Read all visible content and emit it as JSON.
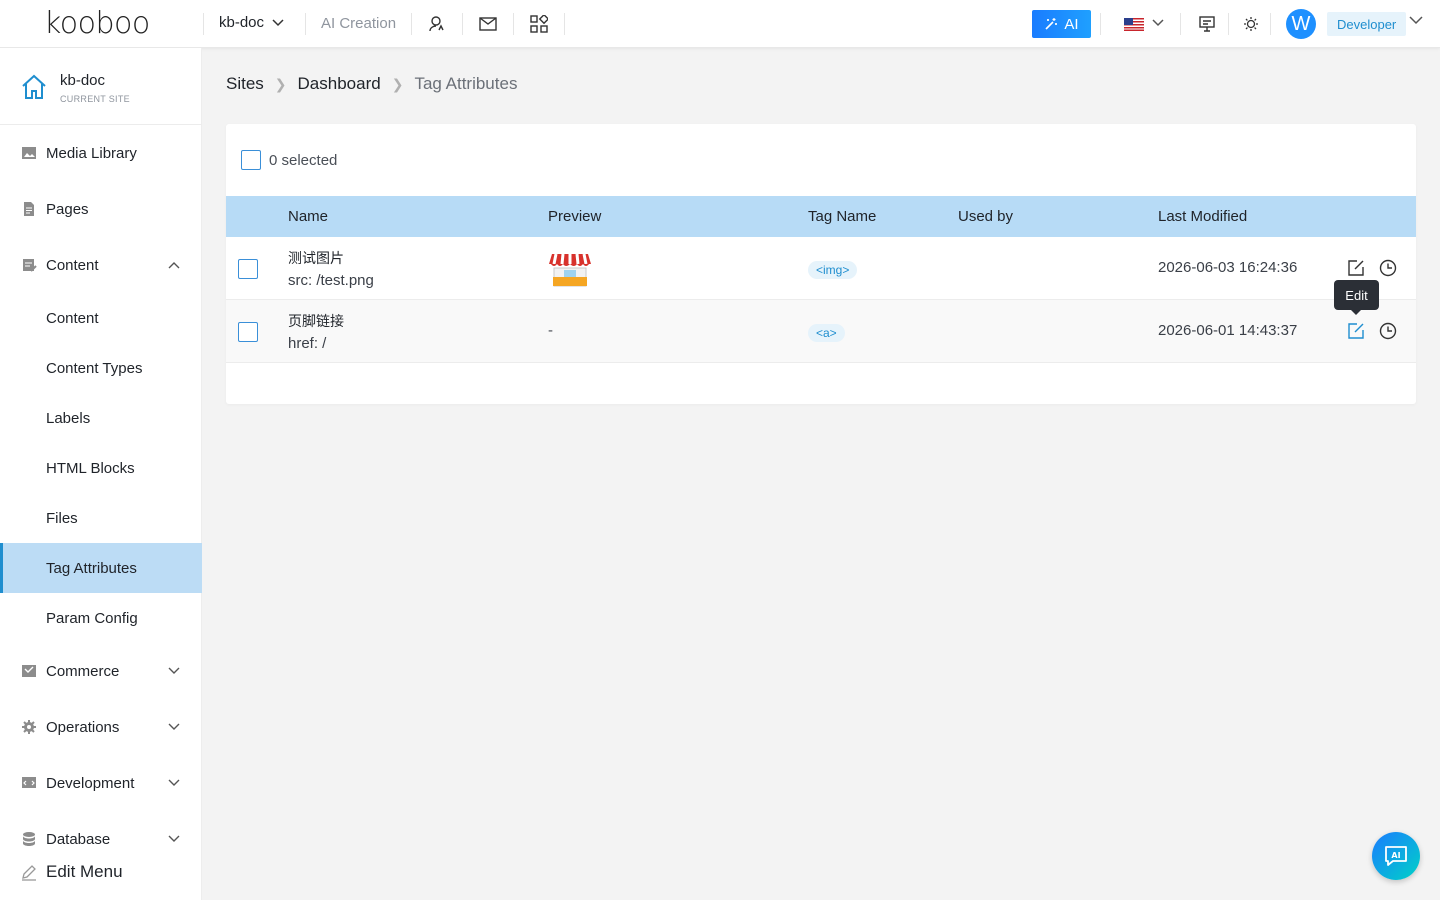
{
  "header": {
    "logo": "kooboo",
    "site": "kb-doc",
    "ai_creation": "AI Creation",
    "ai_button": "AI",
    "avatar_letter": "W",
    "role": "Developer"
  },
  "sidebar": {
    "site_name": "kb-doc",
    "site_sub": "CURRENT SITE",
    "items": [
      {
        "label": "Media Library"
      },
      {
        "label": "Pages"
      },
      {
        "label": "Content"
      },
      {
        "label": "Content"
      },
      {
        "label": "Content Types"
      },
      {
        "label": "Labels"
      },
      {
        "label": "HTML Blocks"
      },
      {
        "label": "Files"
      },
      {
        "label": "Tag Attributes"
      },
      {
        "label": "Param Config"
      },
      {
        "label": "Commerce"
      },
      {
        "label": "Operations"
      },
      {
        "label": "Development"
      },
      {
        "label": "Database"
      }
    ],
    "edit_menu": "Edit Menu"
  },
  "breadcrumb": {
    "sites": "Sites",
    "dashboard": "Dashboard",
    "current": "Tag Attributes"
  },
  "table": {
    "selected_text": "0 selected",
    "columns": {
      "name": "Name",
      "preview": "Preview",
      "tag_name": "Tag Name",
      "used_by": "Used by",
      "last_modified": "Last Modified"
    },
    "rows": [
      {
        "name": "测试图片",
        "attr": "src: /test.png",
        "preview": "",
        "tag": "<img>",
        "used_by": "",
        "modified": "2026-06-03 16:24:36"
      },
      {
        "name": "页脚链接",
        "attr": "href: /",
        "preview": "-",
        "tag": "<a>",
        "used_by": "",
        "modified": "2026-06-01 14:43:37"
      }
    ]
  },
  "tooltip": "Edit",
  "colors": {
    "accent": "#1f8ecf",
    "table_header": "#b7dbf6",
    "active_nav": "#bcdcf5"
  }
}
